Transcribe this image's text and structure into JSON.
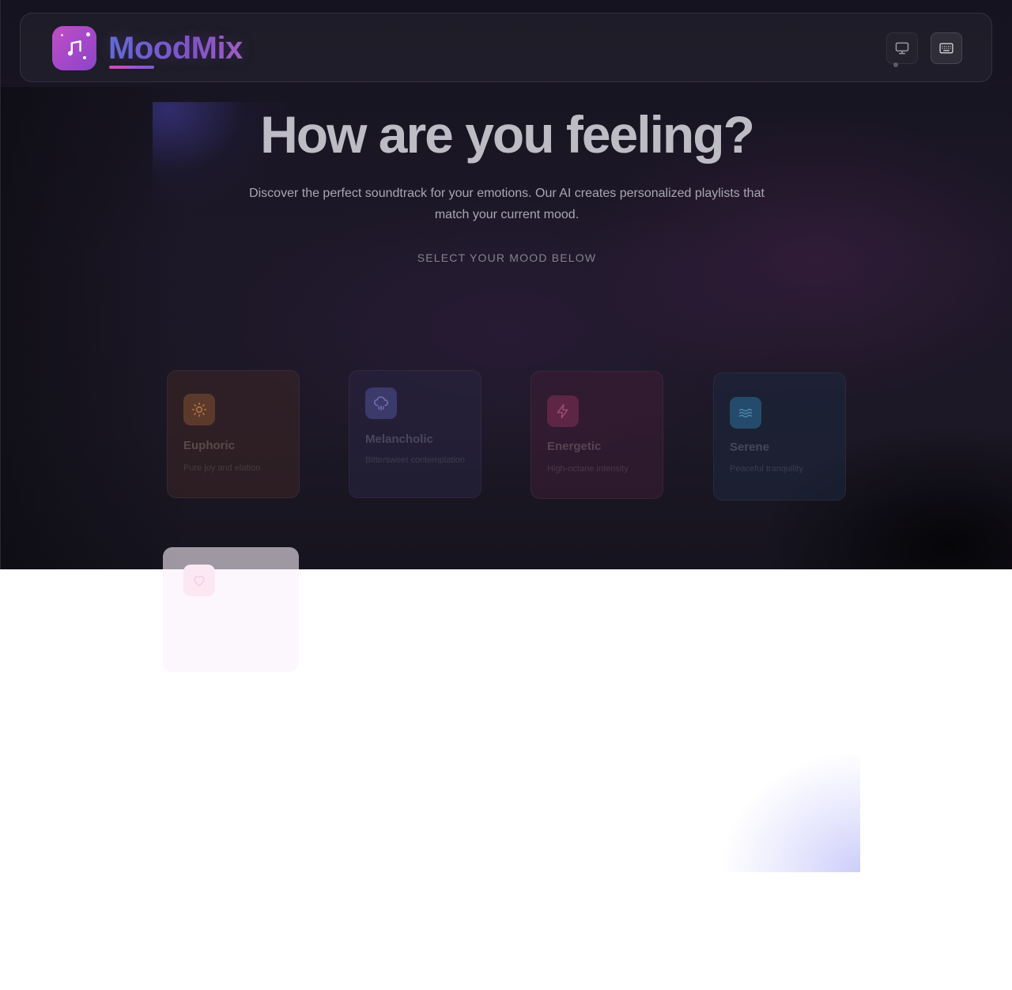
{
  "header": {
    "brand": "MoodMix",
    "logo_icon": "music-note-icon",
    "buttons": [
      {
        "icon": "monitor-icon"
      },
      {
        "icon": "keyboard-icon"
      }
    ]
  },
  "hero": {
    "title": "How are you feeling?",
    "subtitle": "Discover the perfect soundtrack for your emotions. Our AI creates personalized playlists that match your current mood.",
    "hint": "SELECT YOUR MOOD BELOW"
  },
  "moods": [
    {
      "name": "Euphoric",
      "description": "Pure joy and elation",
      "icon": "sun-icon",
      "color": "#f5a15b"
    },
    {
      "name": "Melancholic",
      "description": "Bittersweet contemplation",
      "icon": "cloud-rain-icon",
      "color": "#7b7ad8"
    },
    {
      "name": "Energetic",
      "description": "High-octane intensity",
      "icon": "lightning-icon",
      "color": "#e0498f"
    },
    {
      "name": "Serene",
      "description": "Peaceful tranquility",
      "icon": "waves-icon",
      "color": "#4aa3dd"
    },
    {
      "name": "",
      "description": "",
      "icon": "heart-icon",
      "color": "#f6c3de"
    }
  ],
  "colors": {
    "background": "#1d1828",
    "accent": "#a648c9",
    "brand_gradient_start": "#5e6fd6",
    "brand_gradient_end": "#a35fc4"
  }
}
